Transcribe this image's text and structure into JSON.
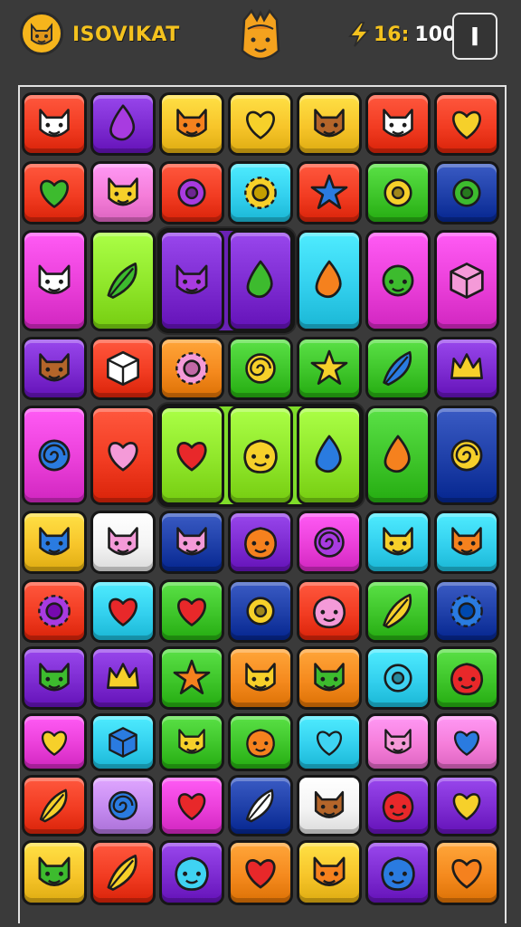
{
  "hud": {
    "player_name": "ISOVIKAT",
    "energy_current": "16:",
    "energy_max": "100",
    "menu_label": "I",
    "avatar_icon": "cat-face-icon",
    "mascot_icon": "fox-mascot-icon",
    "energy_icon": "lightning-bolt-icon"
  },
  "colors": {
    "background": "#3a3a3a",
    "accent": "#f4c21e",
    "red": "#f23c22",
    "purple": "#7d2bd1",
    "yellow": "#f7c52a",
    "cyan": "#33d0ee",
    "green": "#3ec52a",
    "blue": "#1e3fa8",
    "magenta": "#ea3fd9",
    "orange": "#f58a1e",
    "pink": "#f57dd9",
    "lime": "#8fe62a",
    "white": "#f4f4f4",
    "lavender": "#c48af0"
  },
  "board": {
    "rows": [
      [
        {
          "bg": "red",
          "icon": "white-fox-icon"
        },
        {
          "bg": "purple",
          "icon": "purple-crystal-icon"
        },
        {
          "bg": "yellow",
          "icon": "orange-cat-icon"
        },
        {
          "bg": "yellow",
          "icon": "split-heart-icon"
        },
        {
          "bg": "yellow",
          "icon": "brown-fox-icon"
        },
        {
          "bg": "red",
          "icon": "white-cat-icon"
        },
        {
          "bg": "red",
          "icon": "yellow-heart-icon"
        }
      ],
      [
        {
          "bg": "red",
          "icon": "green-heart-icon"
        },
        {
          "bg": "pink",
          "icon": "yellow-cat-icon"
        },
        {
          "bg": "red",
          "icon": "purple-donut-icon"
        },
        {
          "bg": "cyan",
          "icon": "flower-icon"
        },
        {
          "bg": "red",
          "icon": "blue-star-icon"
        },
        {
          "bg": "green",
          "icon": "yellow-donut-icon"
        },
        {
          "bg": "blue",
          "icon": "green-ring-icon"
        }
      ],
      [
        {
          "bg": "magenta",
          "icon": "white-wolf-icon"
        },
        {
          "bg": "lime",
          "icon": "green-leaf-icon"
        },
        {
          "bg": "purple",
          "icon": "purple-devil-icon"
        },
        {
          "bg": "purple",
          "icon": "green-sprout-face-icon"
        },
        {
          "bg": "cyan",
          "icon": "orange-fire-face-icon"
        },
        {
          "bg": "magenta",
          "icon": "green-spiky-face-icon"
        },
        {
          "bg": "magenta",
          "icon": "pink-block-face-icon"
        }
      ],
      [
        {
          "bg": "purple",
          "icon": "brown-fox-icon"
        },
        {
          "bg": "red",
          "icon": "white-cube-icon"
        },
        {
          "bg": "orange",
          "icon": "pink-sun-icon"
        },
        {
          "bg": "green",
          "icon": "rainbow-swirl-icon"
        },
        {
          "bg": "green",
          "icon": "yellow-star-rock-icon"
        },
        {
          "bg": "green",
          "icon": "blue-wand-icon"
        },
        {
          "bg": "purple",
          "icon": "winged-helmet-icon"
        }
      ],
      [
        {
          "bg": "magenta",
          "icon": "blue-swirl-icon"
        },
        {
          "bg": "red",
          "icon": "pink-heart-icon"
        },
        {
          "bg": "lime",
          "icon": "red-heart-icon"
        },
        {
          "bg": "lime",
          "icon": "yellow-rock-icon"
        },
        {
          "bg": "lime",
          "icon": "blue-drop-icon"
        },
        {
          "bg": "green",
          "icon": "orange-tulip-icon"
        },
        {
          "bg": "blue",
          "icon": "yellow-swirl-icon"
        }
      ],
      [
        {
          "bg": "yellow",
          "icon": "blue-goblin-icon"
        },
        {
          "bg": "white",
          "icon": "pink-devil-icon"
        },
        {
          "bg": "blue",
          "icon": "pink-cat-icon"
        },
        {
          "bg": "purple",
          "icon": "orange-blob-icon"
        },
        {
          "bg": "magenta",
          "icon": "purple-swirl-icon"
        },
        {
          "bg": "cyan",
          "icon": "yellow-cat-icon"
        },
        {
          "bg": "cyan",
          "icon": "orange-fox-icon"
        }
      ],
      [
        {
          "bg": "red",
          "icon": "purple-flower-icon"
        },
        {
          "bg": "cyan",
          "icon": "red-heart-wand-icon"
        },
        {
          "bg": "green",
          "icon": "red-heart-icon"
        },
        {
          "bg": "blue",
          "icon": "yellow-ring-icon"
        },
        {
          "bg": "red",
          "icon": "pink-blob-icon"
        },
        {
          "bg": "green",
          "icon": "yellow-pencil-icon"
        },
        {
          "bg": "blue",
          "icon": "blue-hedgehog-icon"
        }
      ],
      [
        {
          "bg": "purple",
          "icon": "green-goblin-icon"
        },
        {
          "bg": "purple",
          "icon": "yellow-crown-icon"
        },
        {
          "bg": "green",
          "icon": "orange-star-icon"
        },
        {
          "bg": "orange",
          "icon": "yellow-lion-icon"
        },
        {
          "bg": "orange",
          "icon": "green-cat-icon"
        },
        {
          "bg": "cyan",
          "icon": "cyan-ring-icon"
        },
        {
          "bg": "green",
          "icon": "red-blob-icon"
        }
      ],
      [
        {
          "bg": "magenta",
          "icon": "yellow-heart-icon"
        },
        {
          "bg": "cyan",
          "icon": "blue-cube-icon"
        },
        {
          "bg": "green",
          "icon": "yellow-cat-icon"
        },
        {
          "bg": "green",
          "icon": "orange-fruit-icon"
        },
        {
          "bg": "cyan",
          "icon": "cyan-heart-icon"
        },
        {
          "bg": "pink",
          "icon": "pink-cat-icon"
        },
        {
          "bg": "pink",
          "icon": "blue-heart-icon"
        }
      ],
      [
        {
          "bg": "red",
          "icon": "yellow-feather-icon"
        },
        {
          "bg": "lavender",
          "icon": "blue-swirl-icon"
        },
        {
          "bg": "magenta",
          "icon": "red-heart-icon"
        },
        {
          "bg": "blue",
          "icon": "white-rocket-icon"
        },
        {
          "bg": "white",
          "icon": "brown-fox-icon"
        },
        {
          "bg": "purple",
          "icon": "red-fruit-icon"
        },
        {
          "bg": "purple",
          "icon": "yellow-bolt-heart-icon"
        }
      ],
      [
        {
          "bg": "yellow",
          "icon": "green-goblin-icon"
        },
        {
          "bg": "red",
          "icon": "yellow-sword-icon"
        },
        {
          "bg": "purple",
          "icon": "cyan-blob-icon"
        },
        {
          "bg": "orange",
          "icon": "red-heart-icon"
        },
        {
          "bg": "yellow",
          "icon": "orange-fox-icon"
        },
        {
          "bg": "purple",
          "icon": "blue-blob-icon"
        },
        {
          "bg": "orange",
          "icon": "orange-heart-icon"
        }
      ]
    ]
  }
}
